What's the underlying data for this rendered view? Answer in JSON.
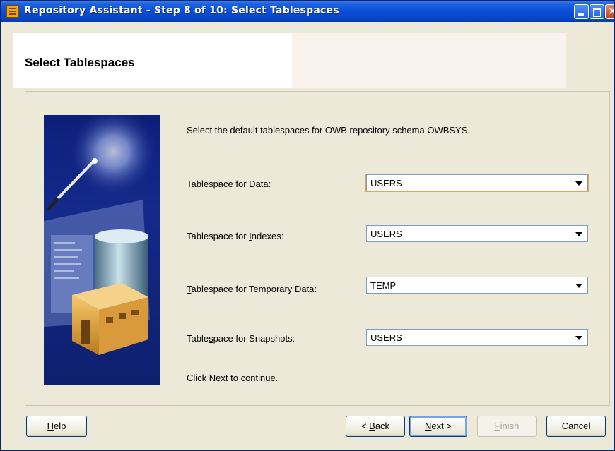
{
  "window": {
    "title": "Repository Assistant - Step 8 of 10: Select Tablespaces"
  },
  "header": {
    "title": "Select Tablespaces"
  },
  "content": {
    "instruction": "Select the default tablespaces for OWB repository schema OWBSYS.",
    "rows": [
      {
        "label_pre": "Tablespace for ",
        "label_key": "D",
        "label_post": "ata:",
        "value": "USERS"
      },
      {
        "label_pre": "Tablespace for ",
        "label_key": "I",
        "label_post": "ndexes:",
        "value": "USERS"
      },
      {
        "label_pre": "",
        "label_key": "T",
        "label_post": "ablespace for Temporary Data:",
        "value": "TEMP"
      },
      {
        "label_pre": "Table",
        "label_key": "s",
        "label_post": "pace for Snapshots:",
        "value": "USERS"
      }
    ],
    "footer": "Click Next to continue."
  },
  "buttons": {
    "help": {
      "key": "H",
      "rest": "elp"
    },
    "back": {
      "pre": "< ",
      "key": "B",
      "rest": "ack"
    },
    "next": {
      "key": "N",
      "rest": "ext >"
    },
    "finish": {
      "key": "F",
      "rest": "inish"
    },
    "cancel": "Cancel"
  },
  "colors": {
    "titlebar": "#0a4fd8",
    "dialog_bg": "#ece9d8",
    "art_bg": "#0b1f7a"
  }
}
